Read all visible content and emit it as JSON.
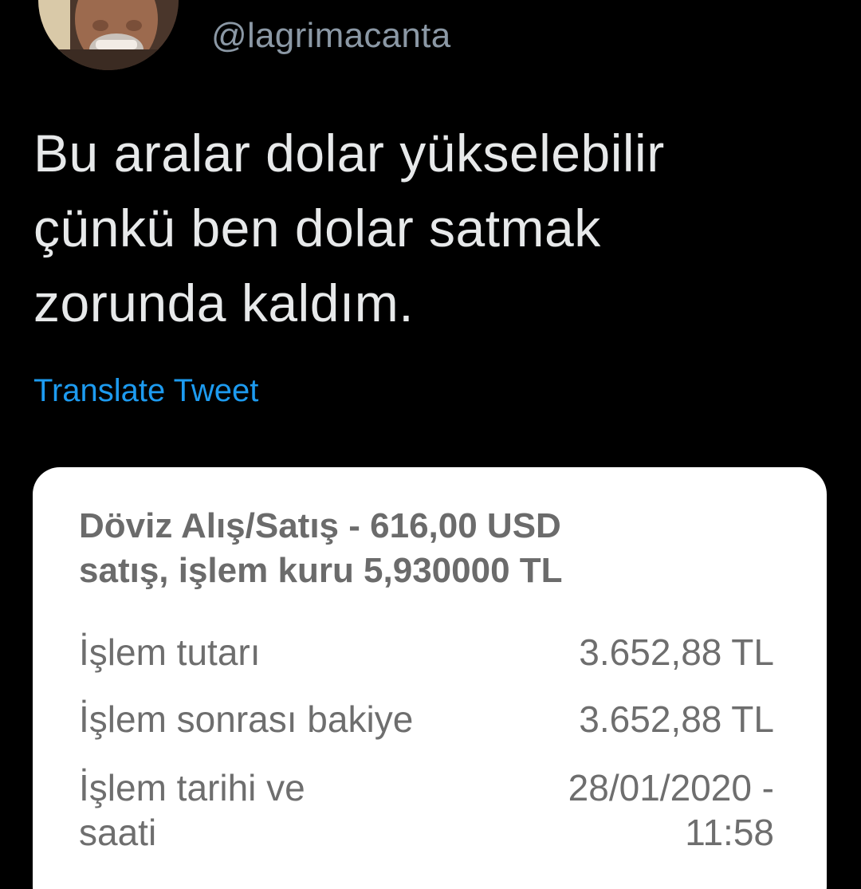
{
  "tweet": {
    "handle": "@lagrimacanta",
    "text_lines": [
      "Bu aralar dolar yükselebilir",
      "çünkü ben dolar satmak",
      "zorunda kaldım."
    ],
    "translate_label": "Translate Tweet"
  },
  "receipt": {
    "title_lines": [
      "Döviz Alış/Satış - 616,00 USD",
      "satış, işlem kuru 5,930000 TL"
    ],
    "rows": [
      {
        "label_lines": [
          "İşlem tutarı"
        ],
        "value_lines": [
          "3.652,88 TL"
        ]
      },
      {
        "label_lines": [
          "İşlem sonrası bakiye"
        ],
        "value_lines": [
          "3.652,88 TL"
        ]
      },
      {
        "label_lines": [
          "İşlem tarihi ve",
          "saati"
        ],
        "value_lines": [
          "28/01/2020 -",
          "11:58"
        ]
      }
    ]
  },
  "colors": {
    "background": "#000000",
    "handle": "#8b98a5",
    "tweet_text": "#e7e9ea",
    "link": "#1d9bf0",
    "card": "#ffffff",
    "card_text": "#6e6e6e"
  },
  "icons": {
    "avatar": "profile-photo"
  }
}
